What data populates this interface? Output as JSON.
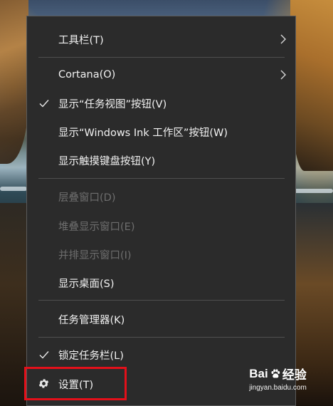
{
  "menu": {
    "items": [
      {
        "label": "工具栏(T)",
        "has_submenu": true,
        "checked": false,
        "disabled": false
      },
      {
        "label": "Cortana(O)",
        "has_submenu": true,
        "checked": false,
        "disabled": false
      },
      {
        "label": "显示“任务视图”按钮(V)",
        "has_submenu": false,
        "checked": true,
        "disabled": false
      },
      {
        "label": "显示“Windows Ink 工作区”按钮(W)",
        "has_submenu": false,
        "checked": false,
        "disabled": false
      },
      {
        "label": "显示触摸键盘按钮(Y)",
        "has_submenu": false,
        "checked": false,
        "disabled": false
      },
      {
        "label": "层叠窗口(D)",
        "has_submenu": false,
        "checked": false,
        "disabled": true
      },
      {
        "label": "堆叠显示窗口(E)",
        "has_submenu": false,
        "checked": false,
        "disabled": true
      },
      {
        "label": "并排显示窗口(I)",
        "has_submenu": false,
        "checked": false,
        "disabled": true
      },
      {
        "label": "显示桌面(S)",
        "has_submenu": false,
        "checked": false,
        "disabled": false
      },
      {
        "label": "任务管理器(K)",
        "has_submenu": false,
        "checked": false,
        "disabled": false
      },
      {
        "label": "锁定任务栏(L)",
        "has_submenu": false,
        "checked": true,
        "disabled": false
      },
      {
        "label": "设置(T)",
        "has_submenu": false,
        "checked": false,
        "disabled": false,
        "icon": "gear-icon"
      }
    ]
  },
  "highlight": {
    "target": "设置(T)",
    "color": "#e3101a"
  },
  "watermark": {
    "text_left": "Bai",
    "text_right": "经验",
    "url": "jingyan.baidu.com"
  },
  "colors": {
    "menu_background": "#2b2b2b",
    "menu_text": "#f2f2f2",
    "disabled_text": "#6e6e6e",
    "separator": "#4f4f4f"
  }
}
